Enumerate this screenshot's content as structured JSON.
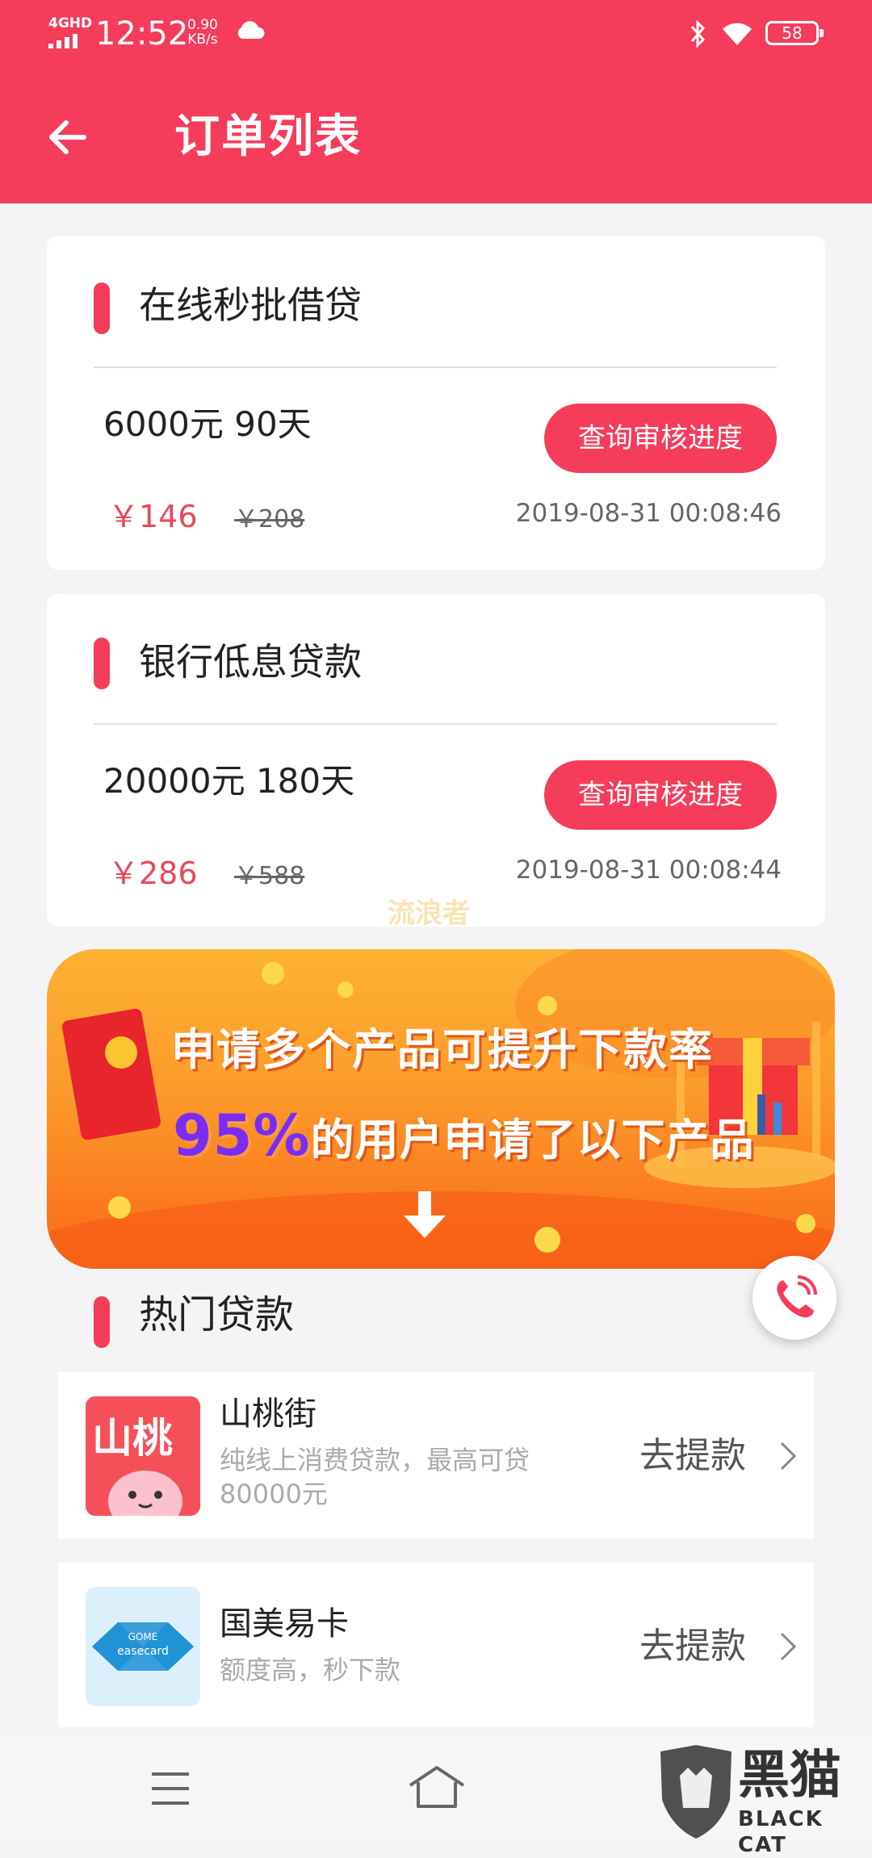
{
  "status_bar": {
    "network": "4GHD",
    "time": "12:52",
    "speed_value": "0.90",
    "speed_unit": "KB/s",
    "battery": "58"
  },
  "header": {
    "title": "订单列表"
  },
  "orders": [
    {
      "name": "在线秒批借贷",
      "amount": "6000元 90天",
      "button": "查询审核进度",
      "price": "￥146",
      "original_price": "￥208",
      "time": "2019-08-31 00:08:46"
    },
    {
      "name": "银行低息贷款",
      "amount": "20000元 180天",
      "button": "查询审核进度",
      "price": "￥286",
      "original_price": "￥588",
      "time": "2019-08-31 00:08:44"
    }
  ],
  "watermark": "流浪者",
  "banner": {
    "line1": "申请多个产品可提升下款率",
    "line2_pct": "95%",
    "line2_rest": "的用户申请了以下产品"
  },
  "hot_section": {
    "title": "热门贷款"
  },
  "loans": [
    {
      "name": "山桃街",
      "desc": "纯线上消费贷款，最高可贷80000元",
      "button": "去提款",
      "logo_text": "山桃"
    },
    {
      "name": "国美易卡",
      "desc": "额度高，秒下款",
      "button": "去提款",
      "logo_text_1": "GOME",
      "logo_text_2": "easecard"
    }
  ],
  "corner_logo": {
    "text_cn": "黑猫",
    "text_en": "BLACK CAT"
  },
  "colors": {
    "primary": "#f53c5a",
    "price": "#e8495a",
    "background": "#f4f4f6"
  }
}
